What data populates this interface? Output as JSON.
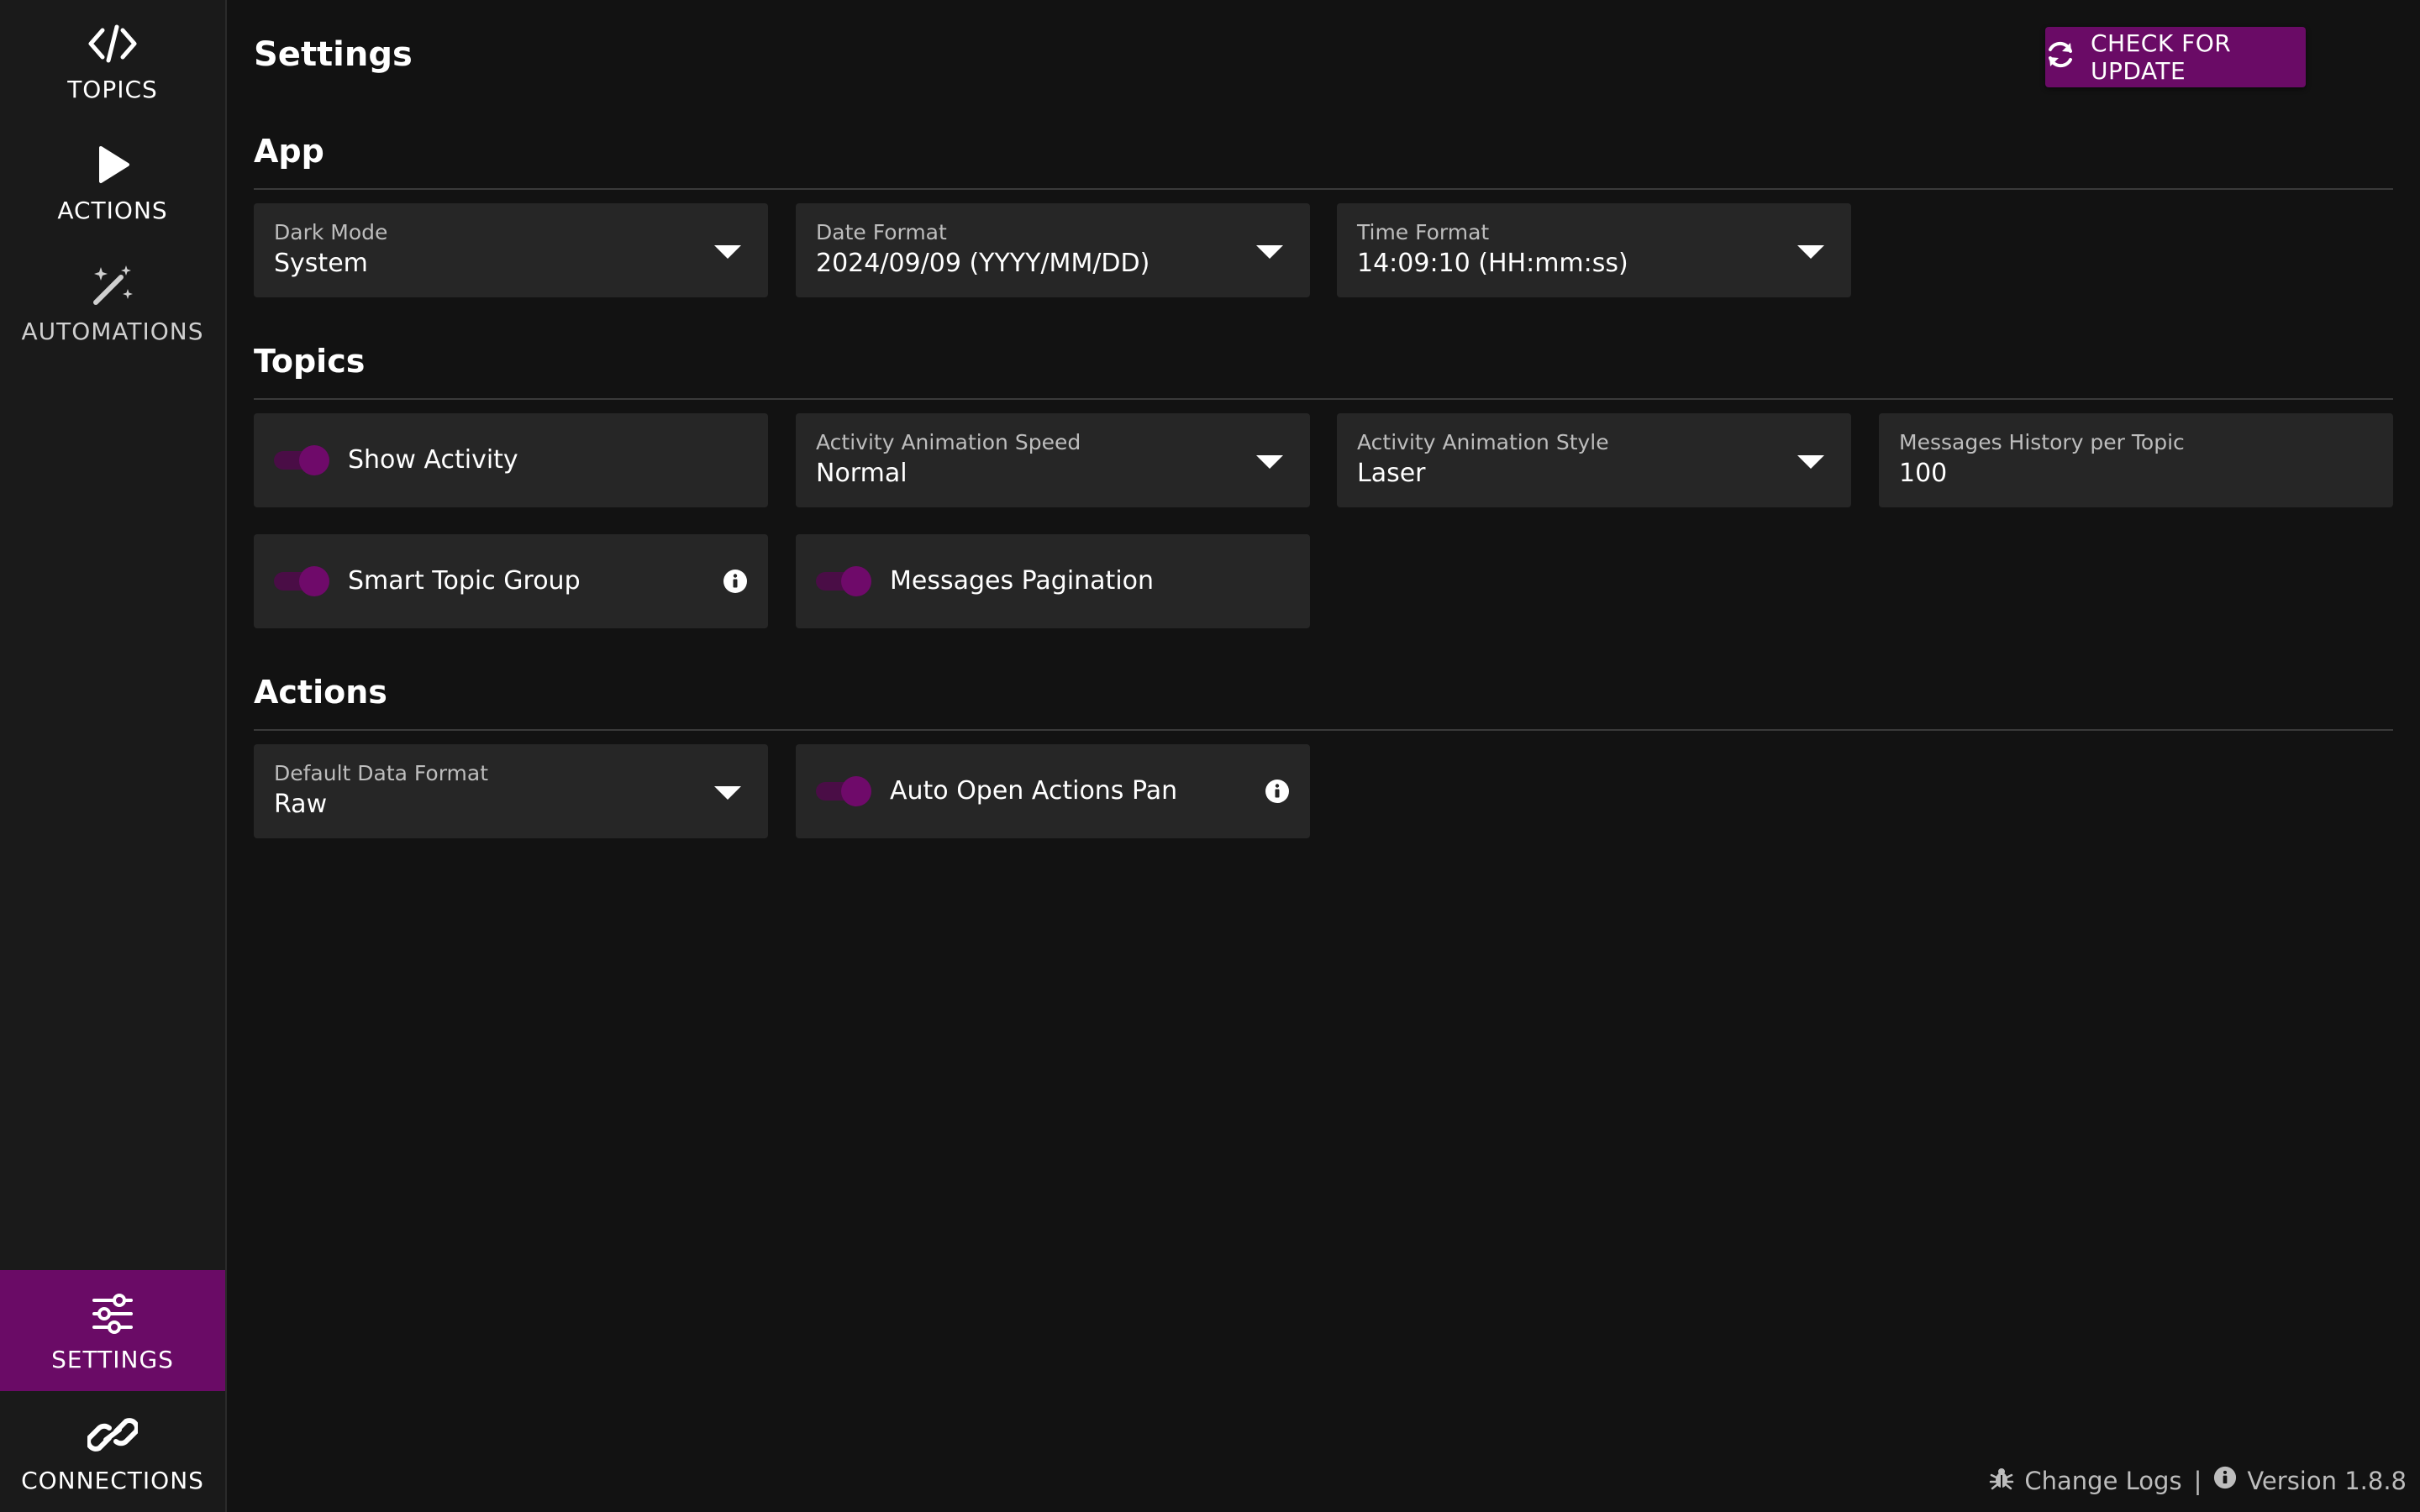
{
  "sidebar": {
    "topics": {
      "label": "TOPICS",
      "icon": "code-icon"
    },
    "actions": {
      "label": "ACTIONS",
      "icon": "play-icon"
    },
    "automations": {
      "label": "AUTOMATIONS",
      "icon": "magic-wand-icon"
    },
    "settings": {
      "label": "SETTINGS",
      "icon": "sliders-icon"
    },
    "connections": {
      "label": "CONNECTIONS",
      "icon": "link-icon"
    }
  },
  "header": {
    "title": "Settings",
    "update_button": "CHECK FOR UPDATE"
  },
  "app": {
    "title": "App",
    "dark_mode": {
      "label": "Dark Mode",
      "value": "System"
    },
    "date_format": {
      "label": "Date Format",
      "value": "2024/09/09 (YYYY/MM/DD)"
    },
    "time_format": {
      "label": "Time Format",
      "value": "14:09:10 (HH:mm:ss)"
    }
  },
  "topics": {
    "title": "Topics",
    "show_activity": {
      "label": "Show Activity",
      "on": true
    },
    "animation_speed": {
      "label": "Activity Animation Speed",
      "value": "Normal"
    },
    "animation_style": {
      "label": "Activity Animation Style",
      "value": "Laser"
    },
    "history": {
      "label": "Messages History per Topic",
      "value": "100"
    },
    "smart_group": {
      "label": "Smart Topic Group",
      "on": true
    },
    "pagination": {
      "label": "Messages Pagination",
      "on": true
    }
  },
  "actions": {
    "title": "Actions",
    "data_format": {
      "label": "Default Data Format",
      "value": "Raw"
    },
    "auto_open": {
      "label": "Auto Open Actions Pan",
      "on": true
    }
  },
  "footer": {
    "changelog": "Change Logs",
    "separator": "|",
    "version": "Version 1.8.8"
  },
  "colors": {
    "accent": "#6a0b66",
    "background": "#121212",
    "sidebar": "#1a1a1a",
    "field": "#262626"
  }
}
